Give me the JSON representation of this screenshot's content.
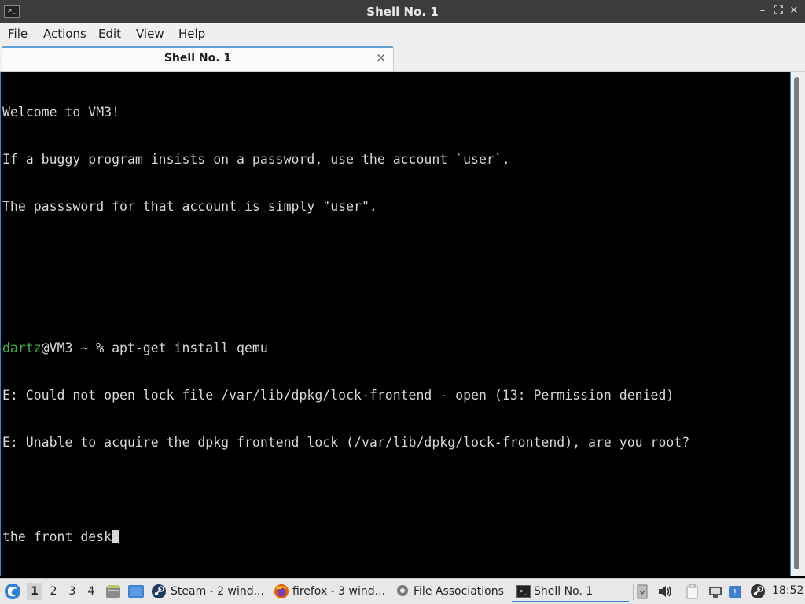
{
  "window": {
    "title": "Shell No. 1",
    "app_icon": "terminal-icon",
    "controls": [
      "minimize-icon",
      "maximize-icon",
      "close-icon"
    ]
  },
  "menu": {
    "file": "File",
    "actions": "Actions",
    "edit": "Edit",
    "view": "View",
    "help": "Help"
  },
  "tab": {
    "label": "Shell No. 1",
    "close": "×"
  },
  "terminal": {
    "line1": "Welcome to VM3!",
    "line2": "If a buggy program insists on a password, use the account `user`.",
    "line3": "The passsword for that account is simply \"user\".",
    "prompt_user": "dartz",
    "prompt_rest": "@VM3 ~ % apt-get install qemu",
    "error1": "E: Could not open lock file /var/lib/dpkg/lock-frontend - open (13: Permission denied)",
    "error2": "E: Unable to acquire the dpkg frontend lock (/var/lib/dpkg/lock-frontend), are you root?",
    "input": "the front desk"
  },
  "colors": {
    "prompt_user": "#3fae3f",
    "accent": "#3d7fcf"
  },
  "taskbar": {
    "desktops": [
      "1",
      "2",
      "3",
      "4"
    ],
    "active_desktop": "1",
    "tasks": {
      "steam": "Steam - 2 wind...",
      "firefox": "firefox - 3 wind...",
      "file_assoc": "File Associations",
      "shell": "Shell No. 1"
    },
    "clock": "18:52"
  }
}
